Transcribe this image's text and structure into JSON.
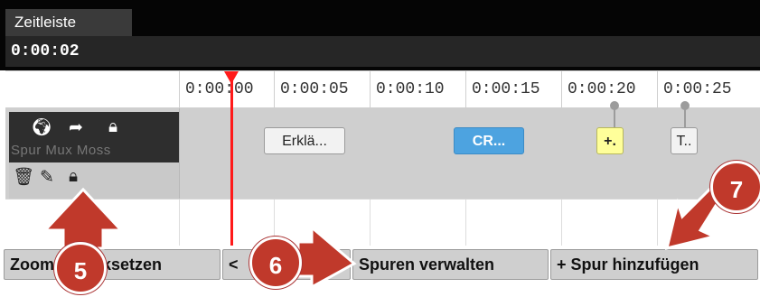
{
  "tab": {
    "label": "Zeitleiste"
  },
  "current_time": "0:00:02",
  "ruler": {
    "ticks": [
      "0:00:00",
      "0:00:05",
      "0:00:10",
      "0:00:15",
      "0:00:20",
      "0:00:25"
    ]
  },
  "track": {
    "name_faded": "Spur Mux Moss",
    "clips": [
      {
        "label": "Erklä...",
        "color": "#f2f2f2"
      },
      {
        "label": "CR...",
        "color": "#4da3e0"
      },
      {
        "label": "+.",
        "color": "#ffff9a"
      },
      {
        "label": "T..",
        "color": "#f2f2f2"
      }
    ]
  },
  "toolbar": {
    "zoom_reset": "Zoom zurücksetzen",
    "prev": "<",
    "manage_tracks": "Spuren verwalten",
    "add_track": "+ Spur hinzufügen"
  },
  "annotations": {
    "badge5": "5",
    "badge6": "6",
    "badge7": "7",
    "color": "#c0392b"
  },
  "icons": [
    "globe-icon",
    "share-arrow-icon",
    "lock-icon",
    "trash-icon",
    "pencil-icon",
    "lock-icon"
  ]
}
